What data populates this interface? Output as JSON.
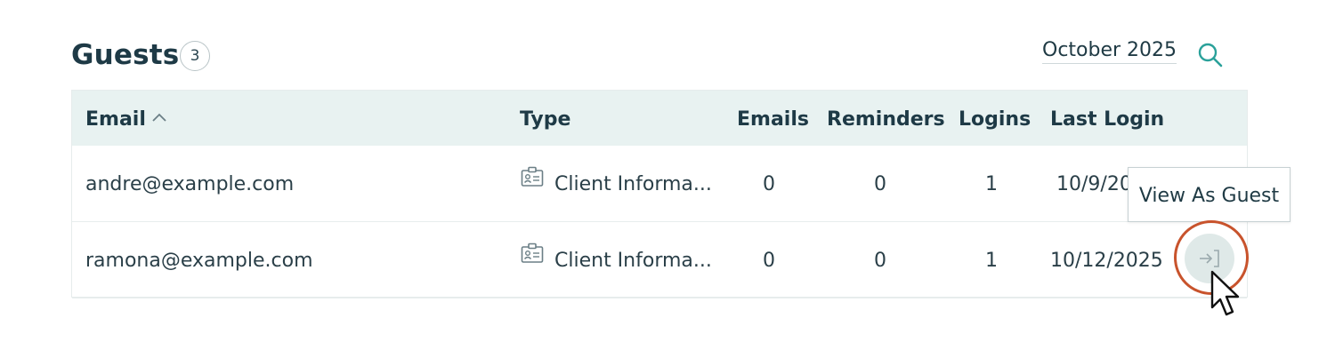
{
  "header": {
    "title": "Guests",
    "count": "3",
    "date_filter": "October 2025",
    "search_icon": "search-icon"
  },
  "table": {
    "columns": {
      "email": "Email",
      "type": "Type",
      "emails": "Emails",
      "reminders": "Reminders",
      "logins": "Logins",
      "last_login": "Last Login"
    },
    "sort": {
      "column": "Email",
      "direction": "ascending",
      "icon": "chevron-up-icon"
    },
    "rows": [
      {
        "email": "andre@example.com",
        "type": "Client Informa...",
        "emails": "0",
        "reminders": "0",
        "logins": "1",
        "last_login": "10/9/20"
      },
      {
        "email": "ramona@example.com",
        "type": "Client Informa...",
        "emails": "0",
        "reminders": "0",
        "logins": "1",
        "last_login": "10/12/2025"
      }
    ]
  },
  "tooltip": {
    "text": "View As Guest"
  },
  "view_as_guest_icon": "sign-in-arrow-icon",
  "colors": {
    "header_bg": "#e8f2f1",
    "accent": "#2aa19a",
    "highlight_ring": "#c8532c",
    "text": "#1e3a46"
  }
}
